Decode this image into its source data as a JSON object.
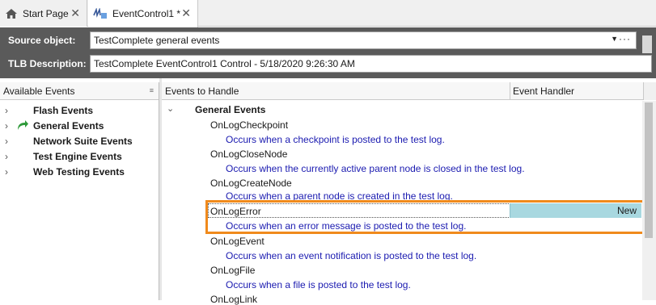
{
  "tabs": [
    {
      "label": "Start Page",
      "icon": "home-icon",
      "close": "✕"
    },
    {
      "label": "EventControl1 *",
      "icon": "events-icon",
      "close": "✕"
    }
  ],
  "properties": {
    "source_object_label": "Source object:",
    "source_object_value": "TestComplete general events",
    "source_object_arrow": "▼",
    "source_object_more": "···",
    "tlb_label": "TLB Description:",
    "tlb_value": "TestComplete EventControl1 Control - 5/18/2020 9:26:30 AM"
  },
  "available_events": {
    "header": "Available Events",
    "sort_icon": "≡",
    "items": [
      {
        "label": "Flash Events",
        "chevron": "›"
      },
      {
        "label": "General Events",
        "chevron": "›",
        "icon": "green-arrow-icon"
      },
      {
        "label": "Network Suite Events",
        "chevron": "›"
      },
      {
        "label": "Test Engine Events",
        "chevron": "›"
      },
      {
        "label": "Web Testing Events",
        "chevron": "›"
      }
    ]
  },
  "events_to_handle": {
    "header": "Events to Handle",
    "handler_header": "Event Handler",
    "group": {
      "label": "General Events",
      "chevron": "⌄"
    },
    "events": [
      {
        "name": "OnLogCheckpoint",
        "desc": "Occurs when a checkpoint is posted to the test log."
      },
      {
        "name": "OnLogCloseNode",
        "desc": "Occurs when the currently active parent node is closed in the test log."
      },
      {
        "name": "OnLogCreateNode",
        "desc": "Occurs when a parent node is created in the test log."
      },
      {
        "name": "OnLogError",
        "desc": "Occurs when an error message is posted to the test log.",
        "handler": "New"
      },
      {
        "name": "OnLogEvent",
        "desc": "Occurs when an event notification is posted to the test log."
      },
      {
        "name": "OnLogFile",
        "desc": "Occurs when a file is posted to the test log."
      }
    ],
    "partial_next": "OnLogLink"
  },
  "colors": {
    "header_band": "#5a5a5a",
    "selection_handler": "#a8d8e0",
    "highlight_box": "#f08a1c",
    "description_text": "#1a1ab0"
  }
}
